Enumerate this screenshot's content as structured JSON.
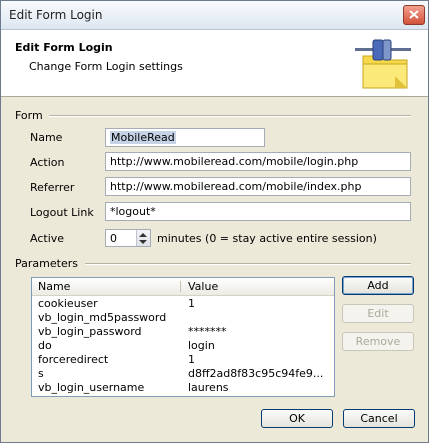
{
  "window": {
    "title": "Edit Form Login"
  },
  "header": {
    "title": "Edit Form Login",
    "subtitle": "Change Form Login settings",
    "icon": "plug-folder-icon"
  },
  "form": {
    "section_label": "Form",
    "name_label": "Name",
    "name_value": "MobileRead",
    "action_label": "Action",
    "action_value": "http://www.mobileread.com/mobile/login.php",
    "referrer_label": "Referrer",
    "referrer_value": "http://www.mobileread.com/mobile/index.php",
    "logout_label": "Logout Link",
    "logout_value": "*logout*",
    "active_label": "Active",
    "active_value": "0",
    "active_suffix": "minutes (0 = stay active entire session)"
  },
  "parameters": {
    "section_label": "Parameters",
    "columns": [
      "Name",
      "Value"
    ],
    "rows": [
      {
        "name": "cookieuser",
        "value": "1"
      },
      {
        "name": "vb_login_md5password",
        "value": ""
      },
      {
        "name": "vb_login_password",
        "value": "*******"
      },
      {
        "name": "do",
        "value": "login"
      },
      {
        "name": "forceredirect",
        "value": "1"
      },
      {
        "name": "s",
        "value": "d8ff2ad8f83c95c94fe9..."
      },
      {
        "name": "vb_login_username",
        "value": "laurens"
      }
    ],
    "add_label": "Add",
    "edit_label": "Edit",
    "remove_label": "Remove"
  },
  "footer": {
    "ok_label": "OK",
    "cancel_label": "Cancel"
  }
}
